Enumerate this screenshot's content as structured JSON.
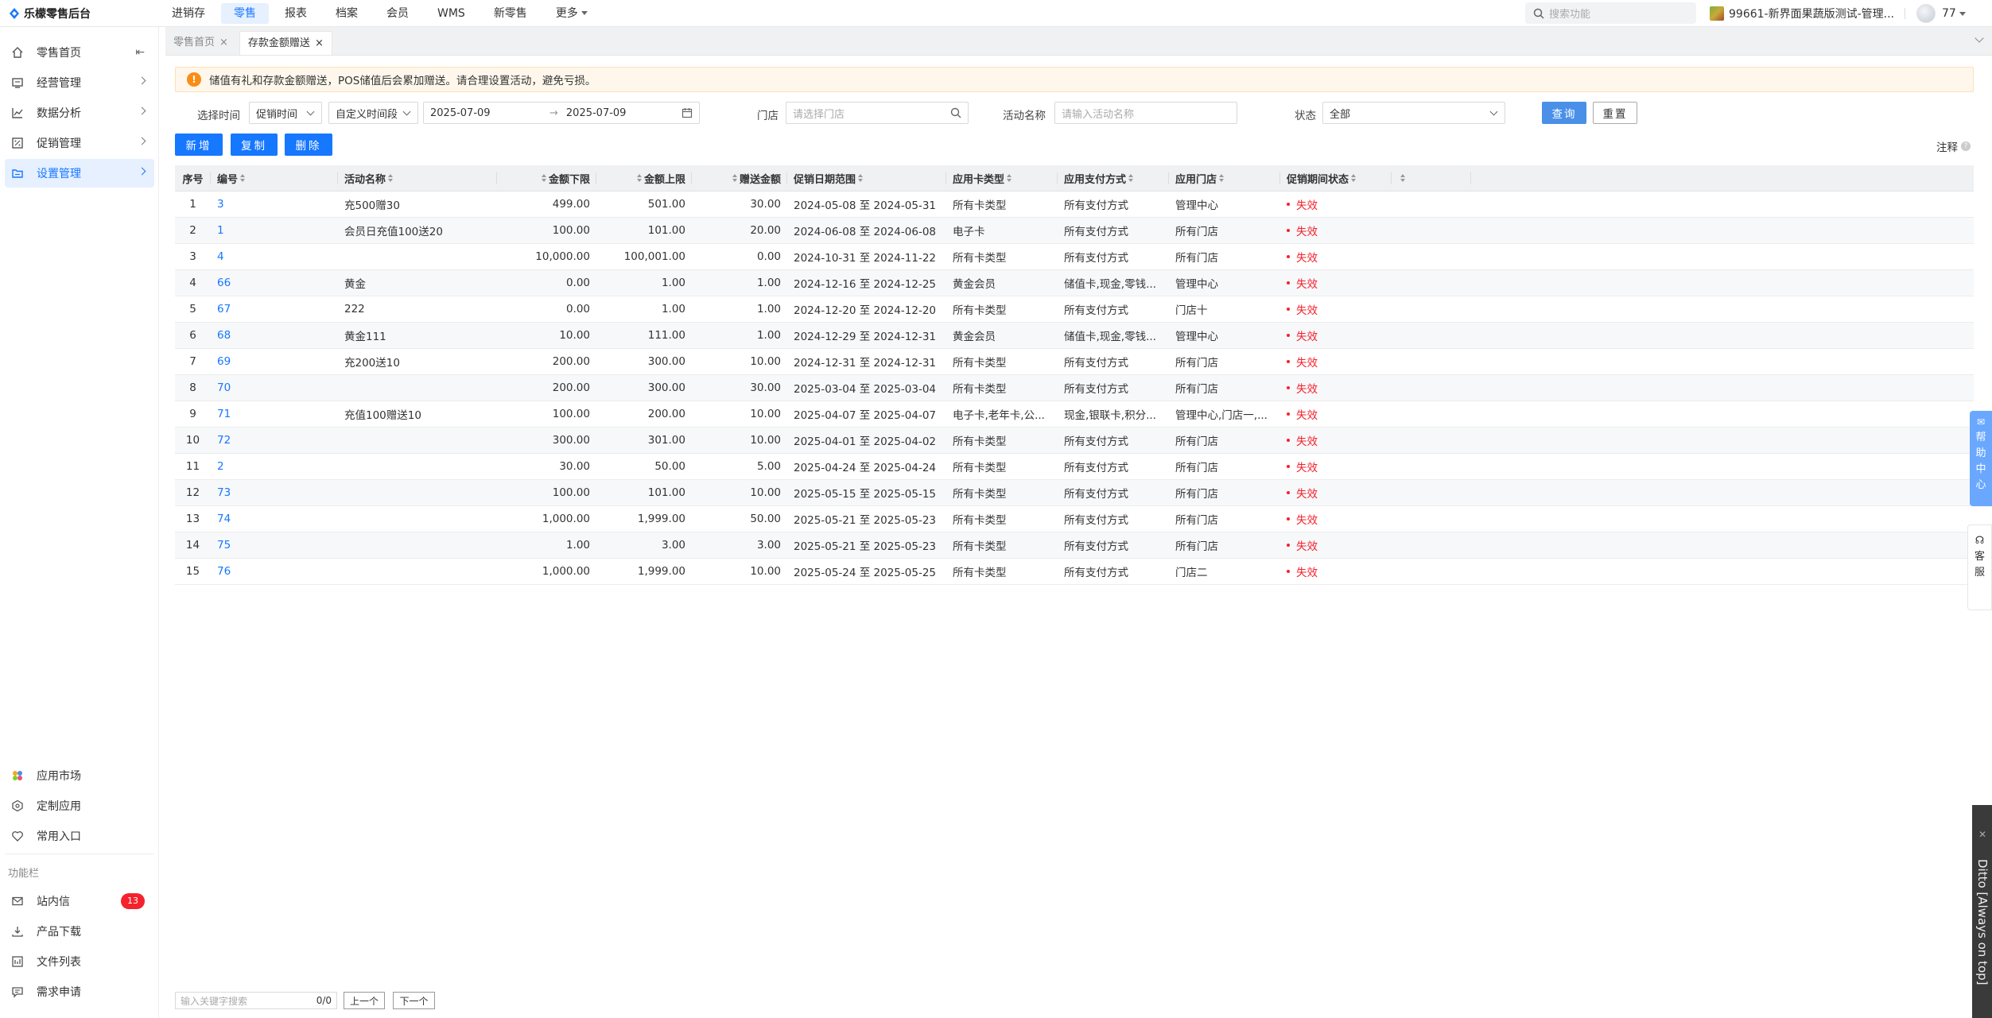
{
  "app": {
    "title": "乐檬零售后台"
  },
  "topnav": {
    "items": [
      "进销存",
      "零售",
      "报表",
      "档案",
      "会员",
      "WMS",
      "新零售",
      "更多"
    ],
    "active_index": 1
  },
  "top_search": {
    "placeholder": "搜索功能"
  },
  "store": {
    "name": "99661-新界面果蔬版测试-管理..."
  },
  "user": {
    "name": "77"
  },
  "sidebar": {
    "items": [
      {
        "label": "零售首页",
        "icon": "home-icon"
      },
      {
        "label": "经营管理",
        "icon": "monitor-icon"
      },
      {
        "label": "数据分析",
        "icon": "chart-icon"
      },
      {
        "label": "促销管理",
        "icon": "promotion-icon"
      },
      {
        "label": "设置管理",
        "icon": "folder-icon",
        "active": true
      }
    ],
    "bottom_items": [
      {
        "label": "应用市场",
        "icon": "app-market-icon"
      },
      {
        "label": "定制应用",
        "icon": "custom-app-icon"
      },
      {
        "label": "常用入口",
        "icon": "heart-icon"
      }
    ],
    "section_label": "功能栏",
    "func_items": [
      {
        "label": "站内信",
        "icon": "mail-icon",
        "badge": "13"
      },
      {
        "label": "产品下载",
        "icon": "download-icon"
      },
      {
        "label": "文件列表",
        "icon": "file-list-icon"
      },
      {
        "label": "需求申请",
        "icon": "request-icon"
      }
    ]
  },
  "tabs": [
    {
      "label": "零售首页",
      "close": "×"
    },
    {
      "label": "存款金额赠送",
      "close": "×"
    }
  ],
  "notice": {
    "icon": "!",
    "text": "储值有礼和存款金额赠送，POS储值后会累加赠送。请合理设置活动，避免亏损。"
  },
  "filters": {
    "time_label": "选择时间",
    "time_type": "促销时间",
    "range_type": "自定义时间段",
    "date_start": "2025-07-09",
    "date_sep": "→",
    "date_end": "2025-07-09",
    "store_label": "门店",
    "store_placeholder": "请选择门店",
    "activity_label": "活动名称",
    "activity_placeholder": "请输入活动名称",
    "status_label": "状态",
    "status_value": "全部",
    "query_btn": "查询",
    "reset_btn": "重置"
  },
  "actions": {
    "add": "新增",
    "copy": "复制",
    "delete": "删除",
    "annotation": "注释"
  },
  "table": {
    "headers": [
      "序号",
      "编号",
      "活动名称",
      "金额下限",
      "金额上限",
      "赠送金额",
      "促销日期范围",
      "应用卡类型",
      "应用支付方式",
      "应用门店",
      "促销期间状态"
    ],
    "rows": [
      [
        "1",
        "3",
        "充500赠30",
        "499.00",
        "501.00",
        "30.00",
        "2024-05-08 至 2024-05-31",
        "所有卡类型",
        "所有支付方式",
        "管理中心",
        "失效"
      ],
      [
        "2",
        "1",
        "会员日充值100送20",
        "100.00",
        "101.00",
        "20.00",
        "2024-06-08 至 2024-06-08",
        "电子卡",
        "所有支付方式",
        "所有门店",
        "失效"
      ],
      [
        "3",
        "4",
        "",
        "10,000.00",
        "100,001.00",
        "0.00",
        "2024-10-31 至 2024-11-22",
        "所有卡类型",
        "所有支付方式",
        "所有门店",
        "失效"
      ],
      [
        "4",
        "66",
        "黄金",
        "0.00",
        "1.00",
        "1.00",
        "2024-12-16 至 2024-12-25",
        "黄金会员",
        "储值卡,现金,零钱...",
        "管理中心",
        "失效"
      ],
      [
        "5",
        "67",
        "222",
        "0.00",
        "1.00",
        "1.00",
        "2024-12-20 至 2024-12-20",
        "所有卡类型",
        "所有支付方式",
        "门店十",
        "失效"
      ],
      [
        "6",
        "68",
        "黄金111",
        "10.00",
        "111.00",
        "1.00",
        "2024-12-29 至 2024-12-31",
        "黄金会员",
        "储值卡,现金,零钱...",
        "管理中心",
        "失效"
      ],
      [
        "7",
        "69",
        "充200送10",
        "200.00",
        "300.00",
        "10.00",
        "2024-12-31 至 2024-12-31",
        "所有卡类型",
        "所有支付方式",
        "所有门店",
        "失效"
      ],
      [
        "8",
        "70",
        "",
        "200.00",
        "300.00",
        "30.00",
        "2025-03-04 至 2025-03-04",
        "所有卡类型",
        "所有支付方式",
        "所有门店",
        "失效"
      ],
      [
        "9",
        "71",
        "充值100赠送10",
        "100.00",
        "200.00",
        "10.00",
        "2025-04-07 至 2025-04-07",
        "电子卡,老年卡,公...",
        "现金,银联卡,积分...",
        "管理中心,门店一,...",
        "失效"
      ],
      [
        "10",
        "72",
        "",
        "300.00",
        "301.00",
        "10.00",
        "2025-04-01 至 2025-04-02",
        "所有卡类型",
        "所有支付方式",
        "所有门店",
        "失效"
      ],
      [
        "11",
        "2",
        "",
        "30.00",
        "50.00",
        "5.00",
        "2025-04-24 至 2025-04-24",
        "所有卡类型",
        "所有支付方式",
        "所有门店",
        "失效"
      ],
      [
        "12",
        "73",
        "",
        "100.00",
        "101.00",
        "10.00",
        "2025-05-15 至 2025-05-15",
        "所有卡类型",
        "所有支付方式",
        "所有门店",
        "失效"
      ],
      [
        "13",
        "74",
        "",
        "1,000.00",
        "1,999.00",
        "50.00",
        "2025-05-21 至 2025-05-23",
        "所有卡类型",
        "所有支付方式",
        "所有门店",
        "失效"
      ],
      [
        "14",
        "75",
        "",
        "1.00",
        "3.00",
        "3.00",
        "2025-05-21 至 2025-05-23",
        "所有卡类型",
        "所有支付方式",
        "所有门店",
        "失效"
      ],
      [
        "15",
        "76",
        "",
        "1,000.00",
        "1,999.00",
        "10.00",
        "2025-05-24 至 2025-05-25",
        "所有卡类型",
        "所有支付方式",
        "门店二",
        "失效"
      ]
    ]
  },
  "bottom_search": {
    "placeholder": "输入关键字搜索",
    "count": "0/0",
    "prev": "上一个",
    "next": "下一个"
  },
  "float": {
    "help": [
      "帮",
      "助",
      "中",
      "心"
    ],
    "service": [
      "客",
      "服"
    ],
    "ditto": "Ditto [Always on top]"
  },
  "colors": {
    "primary": "#1677ff",
    "status_invalid": "#f5222d",
    "notice_bg": "#fff7ec"
  }
}
